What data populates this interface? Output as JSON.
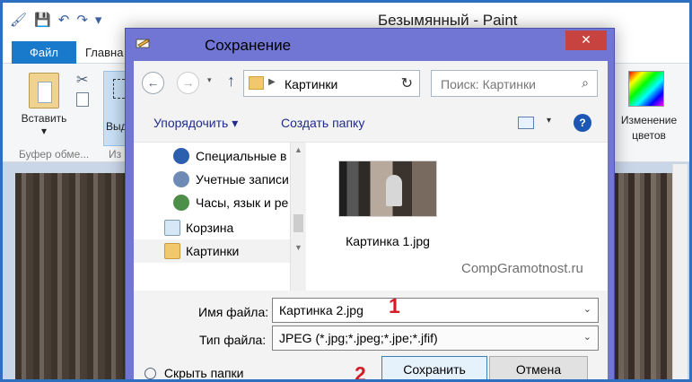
{
  "paint": {
    "window_title": "Безымянный - Paint",
    "file_tab": "Файл",
    "home_tab": "Главна",
    "paste_label": "Вставить",
    "select_label": "Выд",
    "clipboard_group": "Буфер обме...",
    "image_group": "Из",
    "edit_colors_label": "Изменение цветов"
  },
  "dialog": {
    "title": "Сохранение",
    "address": "Картинки",
    "search_placeholder": "Поиск: Картинки",
    "toolbar": {
      "organize": "Упорядочить",
      "new_folder": "Создать папку"
    },
    "nav_items": [
      {
        "label": "Специальные в"
      },
      {
        "label": "Учетные записи"
      },
      {
        "label": "Часы, язык и ре"
      },
      {
        "label": "Корзина"
      },
      {
        "label": "Картинки"
      }
    ],
    "file_label": "Картинка 1.jpg",
    "watermark": "CompGramotnost.ru",
    "form": {
      "file_name_label": "Имя файла:",
      "file_name_value": "Картинка 2.jpg",
      "file_type_label": "Тип файла:",
      "file_type_value": "JPEG (*.jpg;*.jpeg;*.jpe;*.jfif)"
    },
    "hide_folders": "Скрыть папки",
    "save_button": "Сохранить",
    "cancel_button": "Отмена",
    "markers": [
      "1",
      "2"
    ]
  },
  "colors": {
    "dialog_frame": "#7176d5",
    "close_button": "#c7433f",
    "file_tab": "#1979ca",
    "marker_red": "#d51c24"
  }
}
